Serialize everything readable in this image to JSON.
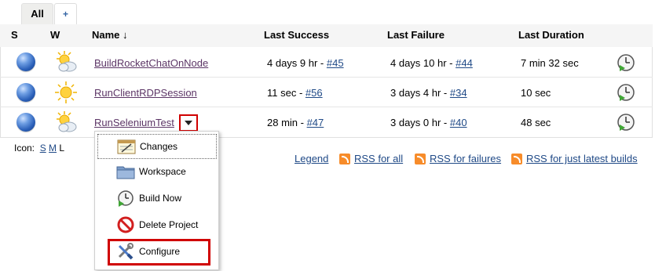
{
  "tabs": {
    "all": "All",
    "add": "+"
  },
  "columns": {
    "s": "S",
    "w": "W",
    "name": "Name ↓",
    "last_success": "Last Success",
    "last_failure": "Last Failure",
    "last_duration": "Last Duration"
  },
  "jobs": [
    {
      "name": "BuildRocketChatOnNode",
      "success_time": "4 days 9 hr - ",
      "success_build": "#45",
      "failure_time": "4 days 10 hr - ",
      "failure_build": "#44",
      "duration": "7 min 32 sec",
      "status_icon": "blue-ball-icon",
      "weather_icon": "partly-cloudy-icon"
    },
    {
      "name": "RunClientRDPSession",
      "success_time": "11 sec - ",
      "success_build": "#56",
      "failure_time": "3 days 4 hr - ",
      "failure_build": "#34",
      "duration": "10 sec",
      "status_icon": "blue-ball-icon",
      "weather_icon": "sunny-icon"
    },
    {
      "name": "RunSeleniumTest",
      "success_time": "28 min - ",
      "success_build": "#47",
      "failure_time": "3 days 0 hr - ",
      "failure_build": "#40",
      "duration": "48 sec",
      "status_icon": "blue-ball-icon",
      "weather_icon": "partly-cloudy-icon"
    }
  ],
  "icon_size": {
    "label": "Icon:",
    "s": "S",
    "m": "M",
    "l": "L"
  },
  "footer": {
    "legend": "Legend",
    "rss_all": "RSS for all",
    "rss_failures": "RSS for failures",
    "rss_latest": "RSS for just latest builds"
  },
  "menu": {
    "items": [
      {
        "label": "Changes",
        "icon": "notepad-icon"
      },
      {
        "label": "Workspace",
        "icon": "folder-icon"
      },
      {
        "label": "Build Now",
        "icon": "clock-build-icon"
      },
      {
        "label": "Delete Project",
        "icon": "no-entry-icon"
      },
      {
        "label": "Configure",
        "icon": "wrench-screwdriver-icon"
      }
    ]
  },
  "colors": {
    "highlight": "#d00000",
    "link": "#204a87",
    "visited_link": "#5c3566",
    "rss": "#f78c2a"
  }
}
